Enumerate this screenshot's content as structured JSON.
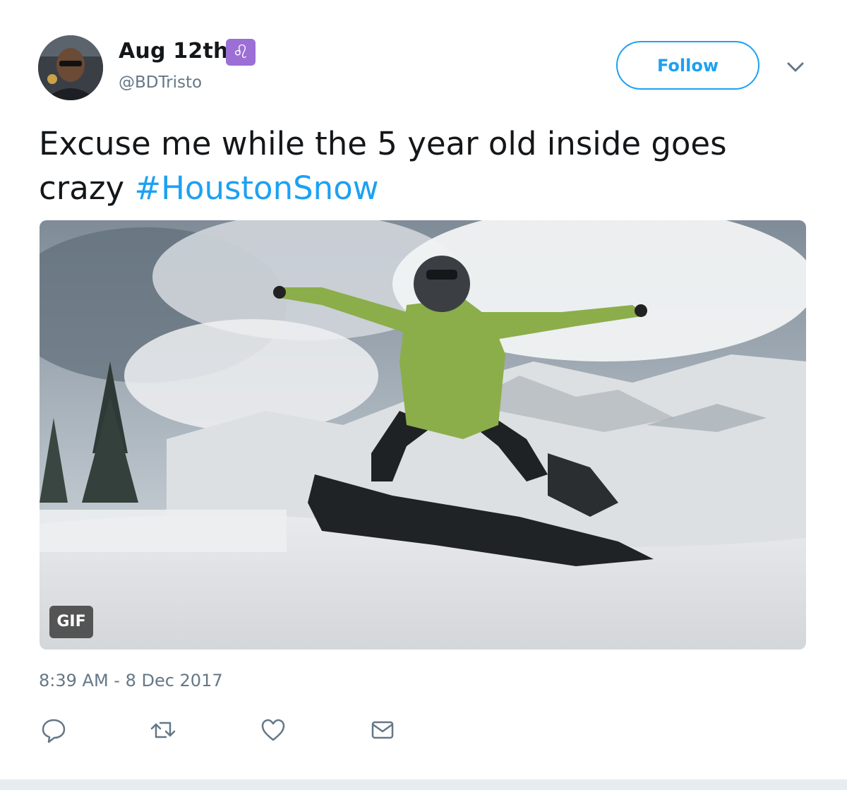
{
  "user": {
    "display_name": "Aug 12th",
    "sign_glyph": "♌",
    "handle": "@BDTristo"
  },
  "follow_label": "Follow",
  "tweet": {
    "text": "Excuse me while the 5 year old inside goes crazy ",
    "hashtag": "#HoustonSnow"
  },
  "media": {
    "badge": "GIF"
  },
  "timestamp": "8:39 AM - 8 Dec 2017",
  "colors": {
    "accent": "#1da1f2",
    "text": "#14171a",
    "muted": "#657786"
  },
  "icons": [
    "reply-icon",
    "retweet-icon",
    "like-icon",
    "direct-message-icon",
    "chevron-down-icon"
  ]
}
